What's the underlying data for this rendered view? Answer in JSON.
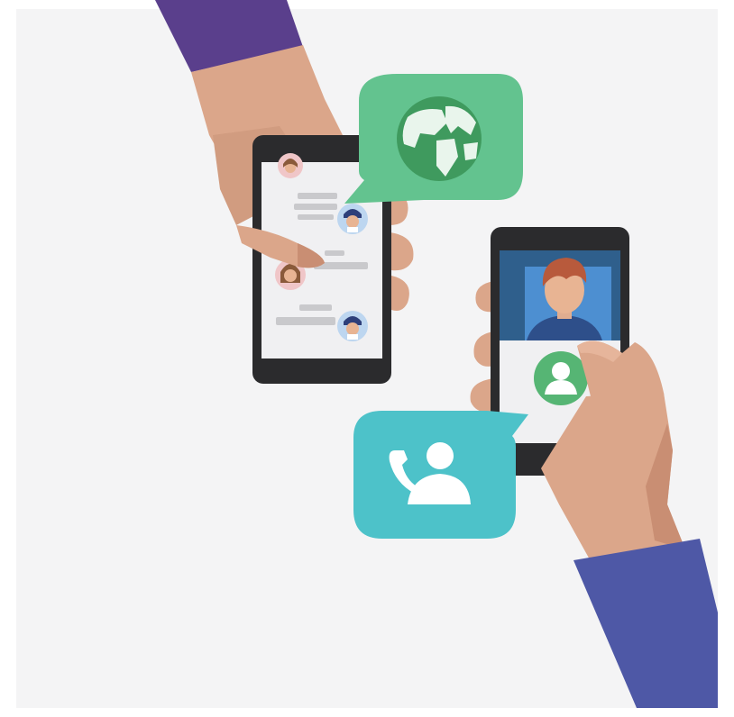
{
  "illustration": {
    "subject": "two-hands-holding-smartphones-chat-and-video-call",
    "icons": [
      "globe-icon",
      "phone-contact-icon",
      "user-avatar-icon"
    ],
    "colors": {
      "background": "#f4f4f5",
      "left_sleeve": "#5a3f8c",
      "right_sleeve": "#4e58a6",
      "skin": "#dba68a",
      "skin_shadow": "#c98e73",
      "phone_body": "#2b2b2d",
      "phone_screen": "#f0f0f2",
      "globe_bubble": "#63c38f",
      "globe": "#3f9a5e",
      "call_bubble": "#4dc2c9",
      "video_blue": "#4d8fd1",
      "video_dark": "#2f5f8c",
      "avatar_green": "#56b574",
      "chat_gray": "#c9c9cc"
    }
  }
}
